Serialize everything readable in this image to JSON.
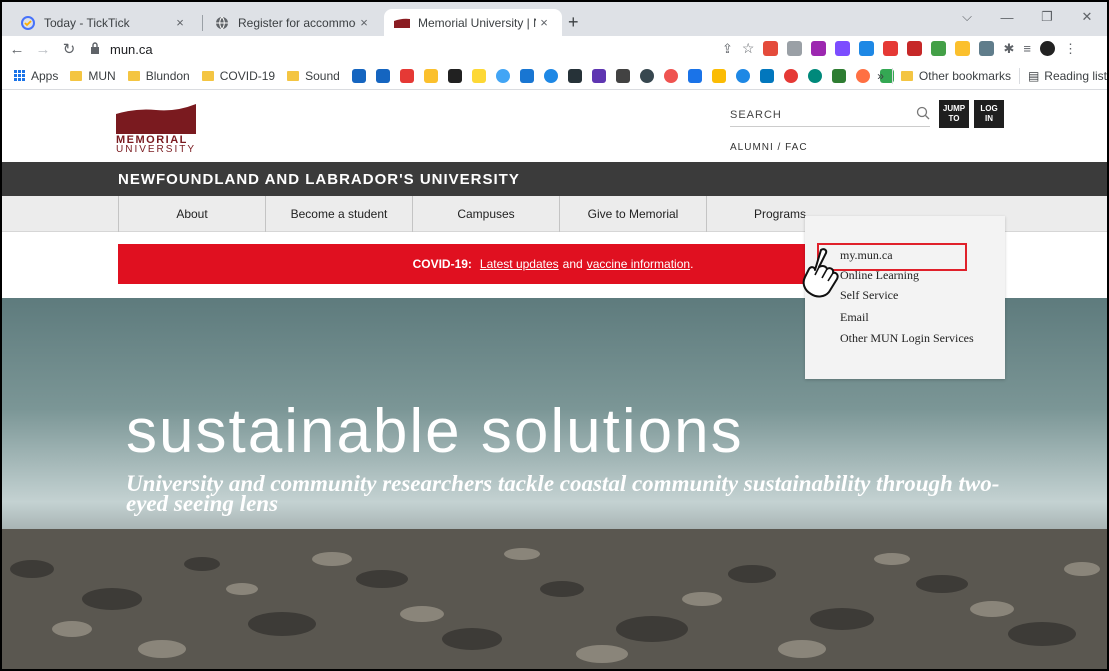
{
  "browser": {
    "tabs": [
      {
        "title": "Today - TickTick",
        "close": "×"
      },
      {
        "title": "Register for accommodations",
        "close": "×"
      },
      {
        "title": "Memorial University | Newfoundl",
        "close": "×"
      }
    ],
    "new_tab": "+",
    "window_controls": [
      "⌵",
      "—",
      "❐",
      "✕"
    ],
    "url": "mun.ca",
    "bookmarks": [
      "Apps",
      "MUN",
      "Blundon",
      "COVID-19",
      "Sound"
    ],
    "bookmarks_overflow": "»",
    "other_bookmarks": "Other bookmarks",
    "reading_list": "Reading list"
  },
  "site": {
    "logo_line1": "MEMORIAL",
    "logo_line2": "UNIVERSITY",
    "search_label": "SEARCH",
    "jump_to": [
      "JUMP",
      "TO"
    ],
    "log_in": [
      "LOG",
      "IN"
    ],
    "alumni_link": "ALUMNI / FAC",
    "tagline": "NEWFOUNDLAND AND LABRADOR'S UNIVERSITY",
    "nav": [
      "About",
      "Become a student",
      "Campuses",
      "Give to Memorial",
      "Programs"
    ],
    "covid": {
      "prefix": "COVID-19:",
      "link1": "Latest updates",
      "middle": "and",
      "link2": "vaccine information",
      "suffix": "."
    },
    "hero_title": "sustainable solutions",
    "hero_subtitle": "University and community researchers tackle coastal community sustainability through two-eyed seeing lens"
  },
  "login_menu": {
    "items": [
      "my.mun.ca",
      "Online Learning",
      "Self Service",
      "Email",
      "Other MUN Login Services"
    ],
    "highlight_color": "#e0202a"
  },
  "colors": {
    "brand": "#7a1a1f",
    "covid_banner": "#e01020",
    "dark_bar": "#3b3b3b"
  }
}
